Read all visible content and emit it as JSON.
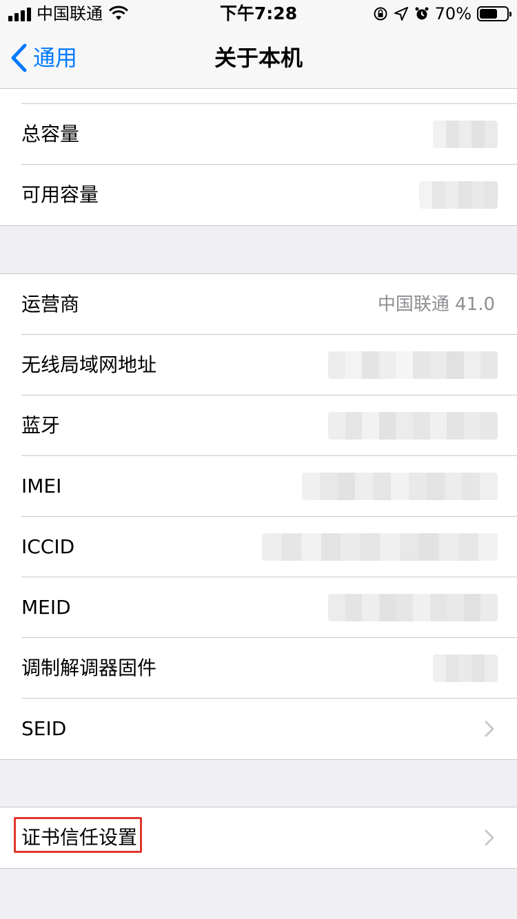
{
  "status_bar": {
    "carrier": "中国联通",
    "time": "下午7:28",
    "battery_percent": "70%",
    "battery_level": 0.7,
    "icons": [
      "signal-icon",
      "wifi-icon",
      "rotation-lock-icon",
      "location-icon",
      "alarm-icon",
      "battery-icon"
    ]
  },
  "nav": {
    "back_label": "通用",
    "title": "关于本机"
  },
  "group1": {
    "rows": [
      {
        "label": "总容量"
      },
      {
        "label": "可用容量"
      }
    ]
  },
  "group2": {
    "rows": [
      {
        "label": "运营商",
        "value": "中国联通 41.0"
      },
      {
        "label": "无线局域网地址"
      },
      {
        "label": "蓝牙"
      },
      {
        "label": "IMEI"
      },
      {
        "label": "ICCID"
      },
      {
        "label": "MEID"
      },
      {
        "label": "调制解调器固件"
      },
      {
        "label": "SEID"
      }
    ]
  },
  "group3": {
    "rows": [
      {
        "label": "证书信任设置"
      }
    ]
  },
  "colors": {
    "accent": "#007aff",
    "highlight_box": "#e0352b",
    "background": "#efeff4"
  }
}
